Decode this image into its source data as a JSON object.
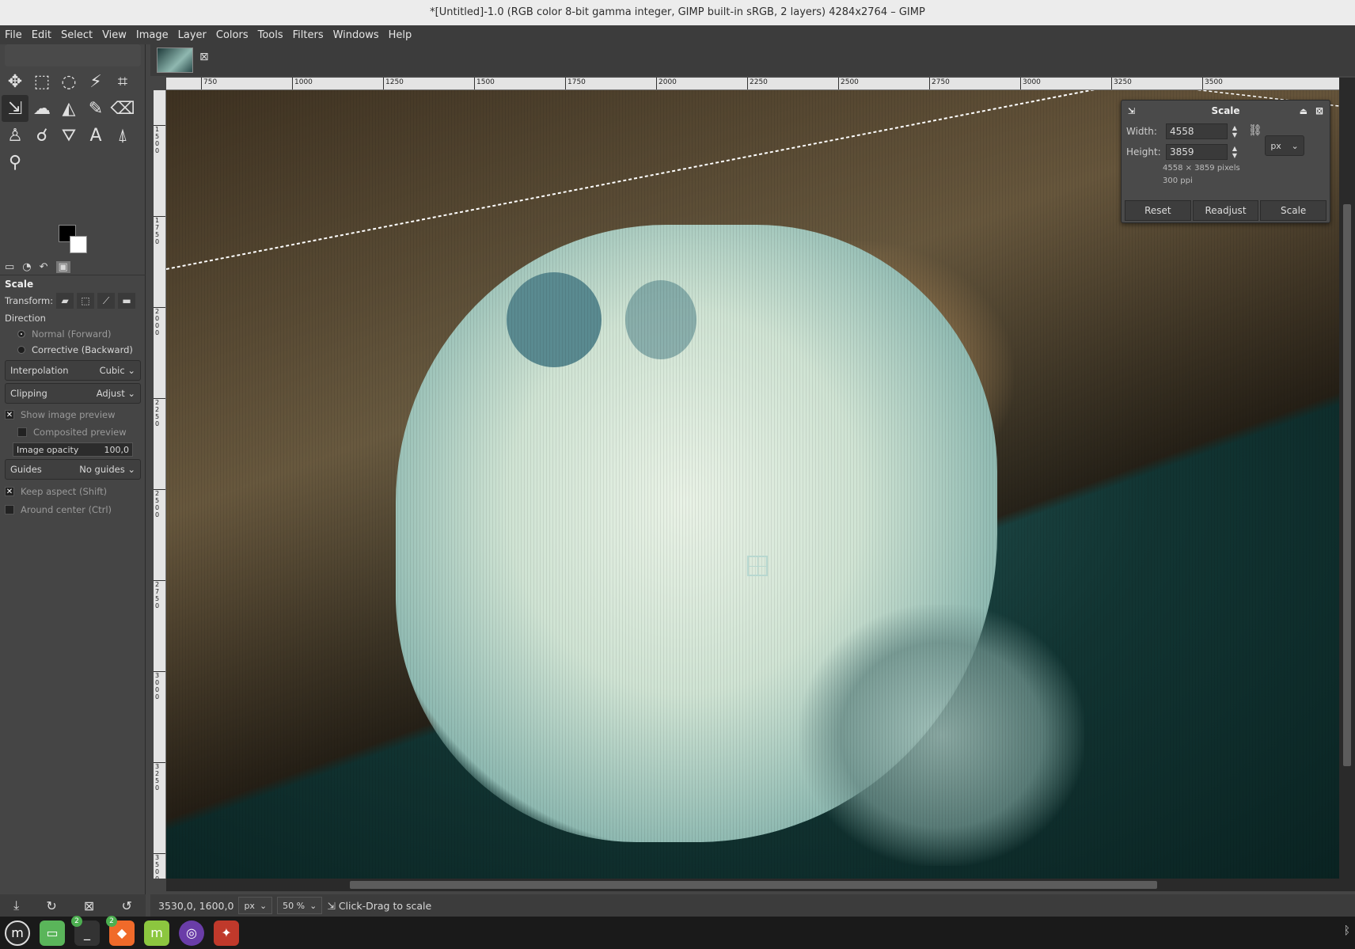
{
  "window": {
    "title": "*[Untitled]-1.0 (RGB color 8-bit gamma integer, GIMP built-in sRGB, 2 layers) 4284x2764 – GIMP"
  },
  "menu": [
    "File",
    "Edit",
    "Select",
    "View",
    "Image",
    "Layer",
    "Colors",
    "Tools",
    "Filters",
    "Windows",
    "Help"
  ],
  "tool_options": {
    "title": "Scale",
    "transform_label": "Transform:",
    "direction_label": "Direction",
    "direction_normal": "Normal (Forward)",
    "direction_corrective": "Corrective (Backward)",
    "interpolation_label": "Interpolation",
    "interpolation_value": "Cubic",
    "clipping_label": "Clipping",
    "clipping_value": "Adjust",
    "show_preview": "Show image preview",
    "composited_preview": "Composited preview",
    "opacity_label": "Image opacity",
    "opacity_value": "100,0",
    "guides_label": "Guides",
    "guides_value": "No guides",
    "keep_aspect": "Keep aspect (Shift)",
    "around_center": "Around center (Ctrl)"
  },
  "ruler": {
    "h_labels": [
      "750",
      "1000",
      "1250",
      "1500",
      "1750",
      "2000",
      "2250",
      "2500",
      "2750",
      "3000",
      "3250",
      "3500"
    ],
    "v_labels": [
      "1500",
      "1750",
      "2000",
      "2250",
      "2500",
      "2750",
      "3000",
      "3250",
      "3500"
    ]
  },
  "scale_dialog": {
    "title": "Scale",
    "width_label": "Width:",
    "width_value": "4558",
    "height_label": "Height:",
    "height_value": "3859",
    "unit": "px",
    "pixels_info": "4558 × 3859 pixels",
    "ppi_info": "300 ppi",
    "reset": "Reset",
    "readjust": "Readjust",
    "scale": "Scale"
  },
  "status": {
    "coords": "3530,0, 1600,0",
    "unit": "px",
    "zoom": "50 %",
    "message": "Click-Drag to scale"
  },
  "taskbar": {
    "badge_terminal": "2",
    "badge_brave": "2"
  }
}
